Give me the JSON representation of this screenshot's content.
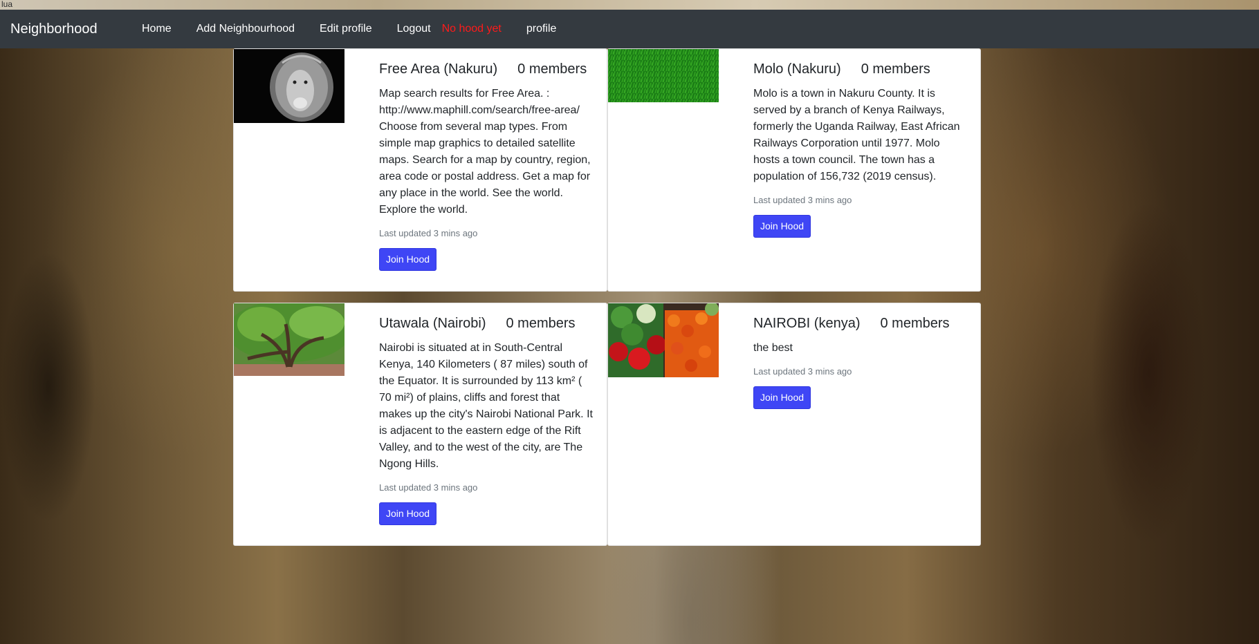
{
  "background": {
    "stray_text": "lua"
  },
  "navbar": {
    "brand": "Neighborhood",
    "links": {
      "home": "Home",
      "add_neighbourhood": "Add Neighbourhood",
      "edit_profile": "Edit profile",
      "logout": "Logout",
      "profile": "profile"
    },
    "status": "No hood yet",
    "status_color": "#ff1a1a"
  },
  "accent_color": "#3f46f5",
  "hoods": [
    {
      "title": "Free Area (Nakuru)",
      "members": "0 members",
      "description": "Map search results for Free Area. : http://www.maphill.com/search/free-area/ Choose from several map types. From simple map graphics to detailed satellite maps. Search for a map by country, region, area code or postal address. Get a map for any place in the world. See the world. Explore the world.",
      "updated": "Last updated 3 mins ago",
      "button": "Join Hood",
      "image": "lion-photo"
    },
    {
      "title": "Molo (Nakuru)",
      "members": "0 members",
      "description": "Molo is a town in Nakuru County. It is served by a branch of Kenya Railways, formerly the Uganda Railway, East African Railways Corporation until 1977. Molo hosts a town council. The town has a population of 156,732 (2019 census).",
      "updated": "Last updated 3 mins ago",
      "button": "Join Hood",
      "image": "grass-photo"
    },
    {
      "title": "Utawala (Nairobi)",
      "members": "0 members",
      "description": "Nairobi is situated at in South-Central Kenya, 140 Kilometers ( 87 miles) south of the Equator. It is surrounded by 113 km² ( 70 mi²) of plains, cliffs and forest that makes up the city's Nairobi National Park. It is adjacent to the eastern edge of the Rift Valley, and to the west of the city, are The Ngong Hills.",
      "updated": "Last updated 3 mins ago",
      "button": "Join Hood",
      "image": "tree-photo"
    },
    {
      "title": "NAIROBI (kenya)",
      "members": "0 members",
      "description": "the best",
      "updated": "Last updated 3 mins ago",
      "button": "Join Hood",
      "image": "vegetables-photo"
    }
  ]
}
